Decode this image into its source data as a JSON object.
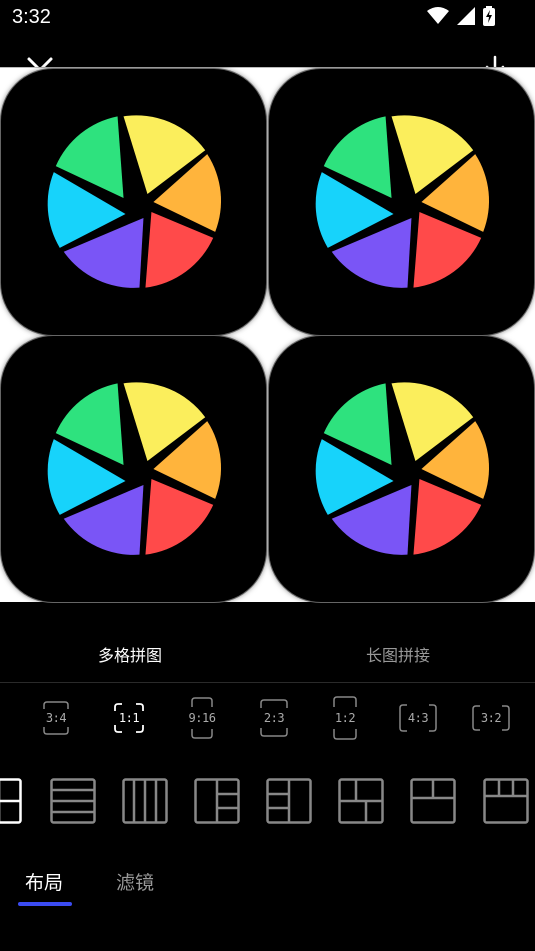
{
  "status_bar": {
    "time": "3:32",
    "icons": [
      "wifi-icon",
      "cellular-signal-icon",
      "battery-charging-icon"
    ]
  },
  "toolbar": {
    "close_icon": "close-icon",
    "download_icon": "download-icon"
  },
  "canvas": {
    "tile_count": 4,
    "tile_image": "colorful-aperture-app-icon",
    "colors": {
      "green": "#2ee27e",
      "yellow": "#fbee5c",
      "orange": "#ffb43c",
      "red": "#ff4a4a",
      "purple": "#7a55f6",
      "blue": "#17d3fb"
    }
  },
  "mode_tabs": [
    {
      "label": "多格拼图",
      "active": true
    },
    {
      "label": "长图拼接",
      "active": false
    }
  ],
  "ratios": [
    {
      "label": "3:4",
      "active": false
    },
    {
      "label": "1:1",
      "active": true
    },
    {
      "label": "9:16",
      "active": false
    },
    {
      "label": "2:3",
      "active": false
    },
    {
      "label": "1:2",
      "active": false
    },
    {
      "label": "4:3",
      "active": false
    },
    {
      "label": "3:2",
      "active": false
    }
  ],
  "layouts": [
    "layout-grid-2x2-partial-icon",
    "layout-four-rows-icon",
    "layout-four-columns-icon",
    "layout-left-one-right-three-icon",
    "layout-left-three-right-one-icon",
    "layout-mixed-grid-icon",
    "layout-top-two-bottom-one-icon",
    "layout-top-three-bottom-one-icon"
  ],
  "bottom_tabs": [
    {
      "label": "布局",
      "active": true
    },
    {
      "label": "滤镜",
      "active": false
    }
  ],
  "accent_color": "#3b4cf2"
}
